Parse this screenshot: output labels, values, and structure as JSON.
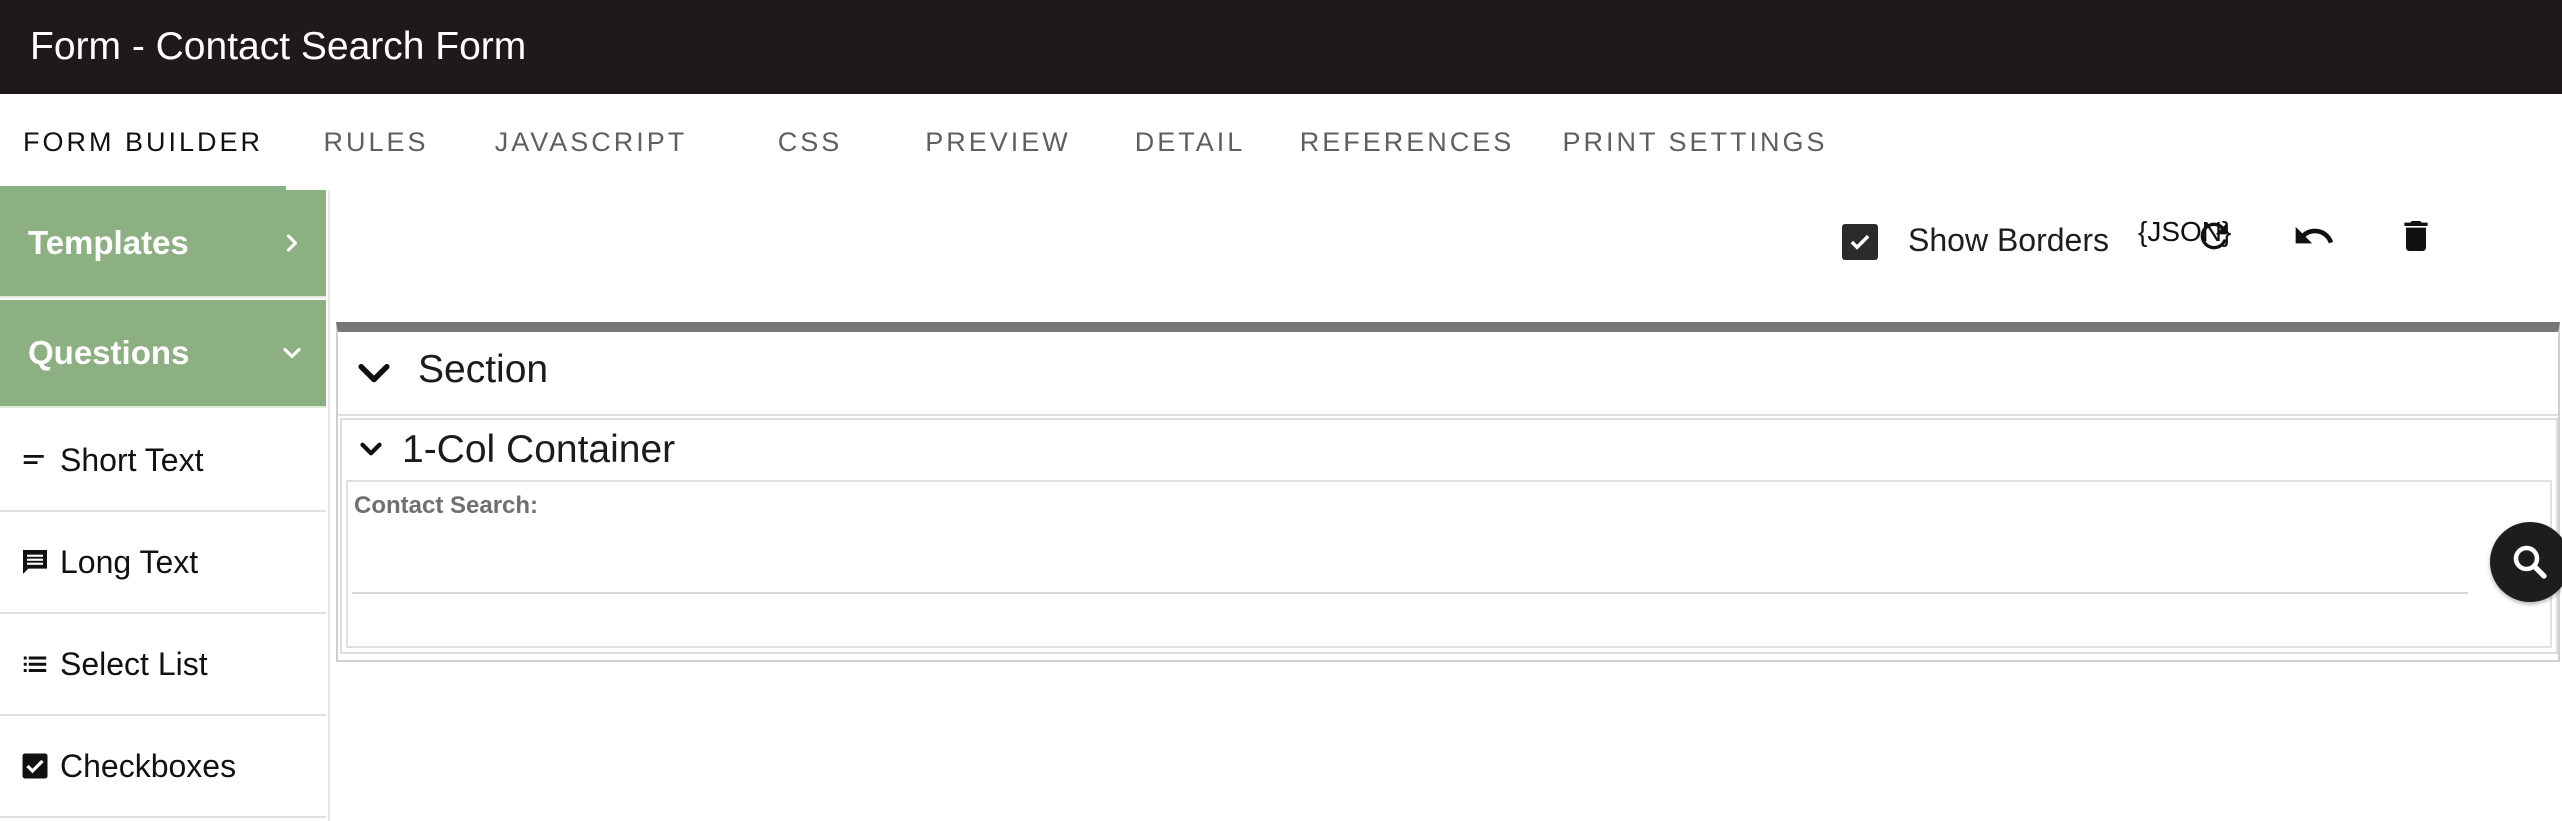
{
  "window": {
    "title": "Form - Contact Search Form"
  },
  "tabs": [
    {
      "label": "FORM BUILDER",
      "active": true
    },
    {
      "label": "RULES",
      "active": false
    },
    {
      "label": "JAVASCRIPT",
      "active": false
    },
    {
      "label": "CSS",
      "active": false
    },
    {
      "label": "PREVIEW",
      "active": false
    },
    {
      "label": "DETAIL",
      "active": false
    },
    {
      "label": "REFERENCES",
      "active": false
    },
    {
      "label": "PRINT SETTINGS",
      "active": false
    }
  ],
  "sidebar": {
    "templates_label": "Templates",
    "questions_label": "Questions",
    "items": [
      {
        "label": "Short Text",
        "icon": "short-text-icon"
      },
      {
        "label": "Long Text",
        "icon": "comment-icon"
      },
      {
        "label": "Select List",
        "icon": "list-icon"
      },
      {
        "label": "Checkboxes",
        "icon": "checkbox-icon"
      }
    ]
  },
  "toolbar": {
    "show_borders_label": "Show Borders",
    "show_borders_checked": true,
    "json_label": "{JSON}"
  },
  "canvas": {
    "section_title": "Section",
    "container_title": "1-Col Container",
    "field_label": "Contact Search:",
    "field_value": ""
  },
  "colors": {
    "titlebar": "#1f1a19",
    "accent_green": "#8db083",
    "tab_underline": "#86b383"
  }
}
